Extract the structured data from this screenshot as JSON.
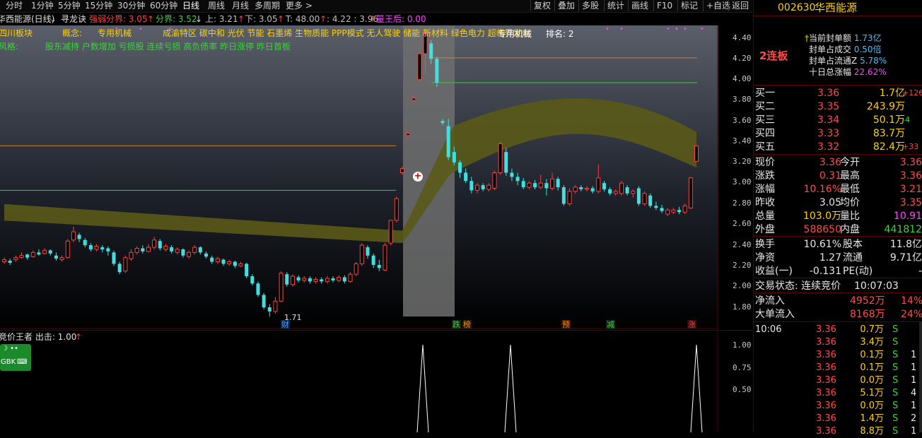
{
  "toolbar": {
    "periods": [
      "分时",
      "1分钟",
      "5分钟",
      "15分钟",
      "30分钟",
      "60分钟",
      "日线",
      "周线",
      "月线",
      "多周期",
      "更多 >"
    ],
    "active_period": "日线",
    "right_buttons": [
      "复权",
      "叠加",
      "多股",
      "统计",
      "画线",
      "F10",
      "标记",
      "+自选",
      "返回"
    ]
  },
  "header": {
    "stock_name": "华西能源(日线)",
    "indicator": "寻龙诀",
    "strong_weak_label": "强弱分界: 3.05",
    "boundary_label": "分界: 3.52",
    "up_label": "上: 3.21",
    "down_label": "下: 3.05",
    "t_label": "T: 48.00",
    "ratio_label": ": 4.22 : 3.96",
    "king_label": "量王后: 0.00",
    "sector_line": "四川板块",
    "concept_label": "概念:",
    "concept_main": "专用机械",
    "concepts": "成渝特区 碳中和 光伏 节能 石墨烯 生物质能 PPP模式 无人驾驶 储能 新材料 绿色电力 超临界发电",
    "overlay_tag": "专用机械",
    "rank_label": "排名: 2",
    "risk_prefix": "风格:",
    "risk_items": "股东减持 户数增加 亏损股 连续亏损 高负债率 昨日涨停 昨日首板"
  },
  "yaxis_main": [
    "4.40",
    "4.20",
    "4.00",
    "3.80",
    "3.60",
    "3.40",
    "3.20",
    "3.00",
    "2.80",
    "2.60",
    "2.40",
    "2.20",
    "2.00",
    "1.80"
  ],
  "low_marker": "1.71",
  "event_markers": [
    {
      "text": "财",
      "color": "#40a0ff"
    },
    {
      "text": "跌",
      "color": "#3cd23c"
    },
    {
      "text": "榜",
      "color": "#ff8800"
    },
    {
      "text": "预",
      "color": "#ff8800"
    },
    {
      "text": "减",
      "color": "#3cd23c"
    },
    {
      "text": "涨",
      "color": "#ff4040"
    }
  ],
  "sub_panel": {
    "title": "竞价王者 出击: 1.00",
    "yaxis": [
      "1.00",
      "0.75",
      "0.50"
    ],
    "ime_label": "GBK"
  },
  "right_panel": {
    "code": "002630",
    "name": "华西能源",
    "streak": "2连板",
    "seal_amount_label": "当前封单额",
    "seal_amount": "1.73亿",
    "seal_vol_label": "封单占成交",
    "seal_vol": "0.50倍",
    "seal_float_label": "封单占流通Z",
    "seal_float": "5.78%",
    "ten_day_label": "十日总涨幅",
    "ten_day": "22.62%",
    "bids": [
      {
        "label": "买一",
        "price": "3.36",
        "vol": "1.7亿",
        "chg": "+126"
      },
      {
        "label": "买二",
        "price": "3.35",
        "vol": "243.9万",
        "chg": ""
      },
      {
        "label": "买三",
        "price": "3.34",
        "vol": "50.1万",
        "chg": "-4"
      },
      {
        "label": "买四",
        "price": "3.33",
        "vol": "83.7万",
        "chg": ""
      },
      {
        "label": "买五",
        "price": "3.32",
        "vol": "82.4万",
        "chg": "+33"
      }
    ],
    "stats": [
      {
        "l1": "现价",
        "v1": "3.36",
        "c1": "red",
        "l2": "今开",
        "v2": "3.36",
        "c2": "red"
      },
      {
        "l1": "涨跌",
        "v1": "0.31",
        "c1": "red",
        "l2": "最高",
        "v2": "3.36",
        "c2": "red"
      },
      {
        "l1": "涨幅",
        "v1": "10.16%",
        "c1": "red",
        "l2": "最低",
        "v2": "3.21",
        "c2": "red"
      },
      {
        "l1": "昨收",
        "v1": "3.05",
        "c1": "white",
        "l2": "均价",
        "v2": "3.35",
        "c2": "red"
      },
      {
        "l1": "总量",
        "v1": "103.0万",
        "c1": "yellow",
        "l2": "量比",
        "v2": "10.91",
        "c2": "mag"
      },
      {
        "l1": "外盘",
        "v1": "588650",
        "c1": "red",
        "l2": "内盘",
        "v2": "441812",
        "c2": "green"
      }
    ],
    "stats2": [
      {
        "l1": "换手",
        "v1": "10.61%",
        "l2": "股本",
        "v2": "11.8亿"
      },
      {
        "l1": "净资",
        "v1": "1.27",
        "l2": "流通",
        "v2": "9.71亿"
      },
      {
        "l1": "收益(一)",
        "v1": "-0.131",
        "l2": "PE(动)",
        "v2": "-"
      }
    ],
    "trade_status_label": "交易状态: 连续竞价",
    "trade_time": "10:07:03",
    "net_inflow_label": "净流入",
    "net_inflow": "4952万",
    "net_inflow_pct": "14%",
    "big_inflow_label": "大单流入",
    "big_inflow": "8168万",
    "big_inflow_pct": "24%",
    "ticks": [
      {
        "time": "10:06",
        "price": "3.36",
        "vol": "0.7万",
        "side": "S",
        "n": ""
      },
      {
        "time": "",
        "price": "3.36",
        "vol": "3.4万",
        "side": "S",
        "n": ""
      },
      {
        "time": "",
        "price": "3.36",
        "vol": "0.1万",
        "side": "S",
        "n": "1"
      },
      {
        "time": "",
        "price": "3.36",
        "vol": "0.1万",
        "side": "S",
        "n": "1"
      },
      {
        "time": "",
        "price": "3.36",
        "vol": "0.0万",
        "side": "S",
        "n": "1"
      },
      {
        "time": "",
        "price": "3.36",
        "vol": "5.1万",
        "side": "S",
        "n": "4"
      },
      {
        "time": "",
        "price": "3.36",
        "vol": "0.0万",
        "side": "S",
        "n": "1"
      },
      {
        "time": "",
        "price": "3.36",
        "vol": "1.4万",
        "side": "S",
        "n": "2"
      },
      {
        "time": "",
        "price": "3.36",
        "vol": "8.8万",
        "side": "S",
        "n": "1"
      }
    ]
  },
  "colors": {
    "up": "#ff4040",
    "down": "#40e0e0",
    "cloud": "#5a5a18",
    "bg": "#000000",
    "border": "#5a0000"
  },
  "chart_data": {
    "type": "candlestick",
    "y_range": [
      1.65,
      4.5
    ],
    "candles": [
      {
        "o": 2.24,
        "c": 2.26,
        "h": 2.28,
        "l": 2.22
      },
      {
        "o": 2.25,
        "c": 2.23,
        "h": 2.27,
        "l": 2.21
      },
      {
        "o": 2.26,
        "c": 2.28,
        "h": 2.3,
        "l": 2.24
      },
      {
        "o": 2.28,
        "c": 2.3,
        "h": 2.33,
        "l": 2.27
      },
      {
        "o": 2.31,
        "c": 2.28,
        "h": 2.32,
        "l": 2.26
      },
      {
        "o": 2.29,
        "c": 2.33,
        "h": 2.35,
        "l": 2.28
      },
      {
        "o": 2.33,
        "c": 2.31,
        "h": 2.36,
        "l": 2.3
      },
      {
        "o": 2.32,
        "c": 2.35,
        "h": 2.37,
        "l": 2.31
      },
      {
        "o": 2.35,
        "c": 2.32,
        "h": 2.36,
        "l": 2.3
      },
      {
        "o": 2.3,
        "c": 2.27,
        "h": 2.33,
        "l": 2.25
      },
      {
        "o": 2.26,
        "c": 2.28,
        "h": 2.3,
        "l": 2.24
      },
      {
        "o": 2.28,
        "c": 2.44,
        "h": 2.46,
        "l": 2.27
      },
      {
        "o": 2.45,
        "c": 2.53,
        "h": 2.58,
        "l": 2.43
      },
      {
        "o": 2.5,
        "c": 2.46,
        "h": 2.52,
        "l": 2.43
      },
      {
        "o": 2.45,
        "c": 2.4,
        "h": 2.47,
        "l": 2.38
      },
      {
        "o": 2.4,
        "c": 2.36,
        "h": 2.42,
        "l": 2.34
      },
      {
        "o": 2.36,
        "c": 2.39,
        "h": 2.41,
        "l": 2.34
      },
      {
        "o": 2.38,
        "c": 2.36,
        "h": 2.4,
        "l": 2.33
      },
      {
        "o": 2.37,
        "c": 2.34,
        "h": 2.39,
        "l": 2.3
      },
      {
        "o": 2.33,
        "c": 2.22,
        "h": 2.35,
        "l": 2.2
      },
      {
        "o": 2.22,
        "c": 2.14,
        "h": 2.24,
        "l": 2.12
      },
      {
        "o": 2.15,
        "c": 2.28,
        "h": 2.3,
        "l": 2.13
      },
      {
        "o": 2.27,
        "c": 2.33,
        "h": 2.36,
        "l": 2.25
      },
      {
        "o": 2.33,
        "c": 2.37,
        "h": 2.39,
        "l": 2.31
      },
      {
        "o": 2.37,
        "c": 2.34,
        "h": 2.4,
        "l": 2.32
      },
      {
        "o": 2.34,
        "c": 2.38,
        "h": 2.41,
        "l": 2.33
      },
      {
        "o": 2.38,
        "c": 2.45,
        "h": 2.48,
        "l": 2.36
      },
      {
        "o": 2.44,
        "c": 2.37,
        "h": 2.46,
        "l": 2.35
      },
      {
        "o": 2.36,
        "c": 2.39,
        "h": 2.41,
        "l": 2.34
      },
      {
        "o": 2.38,
        "c": 2.34,
        "h": 2.4,
        "l": 2.32
      },
      {
        "o": 2.33,
        "c": 2.36,
        "h": 2.38,
        "l": 2.31
      },
      {
        "o": 2.36,
        "c": 2.3,
        "h": 2.37,
        "l": 2.28
      },
      {
        "o": 2.29,
        "c": 2.33,
        "h": 2.35,
        "l": 2.27
      },
      {
        "o": 2.33,
        "c": 2.38,
        "h": 2.4,
        "l": 2.31
      },
      {
        "o": 2.38,
        "c": 2.33,
        "h": 2.39,
        "l": 2.31
      },
      {
        "o": 2.32,
        "c": 2.29,
        "h": 2.34,
        "l": 2.27
      },
      {
        "o": 2.28,
        "c": 2.24,
        "h": 2.3,
        "l": 2.22
      },
      {
        "o": 2.24,
        "c": 2.27,
        "h": 2.29,
        "l": 2.22
      },
      {
        "o": 2.26,
        "c": 2.22,
        "h": 2.27,
        "l": 2.2
      },
      {
        "o": 2.22,
        "c": 2.24,
        "h": 2.26,
        "l": 2.2
      },
      {
        "o": 2.24,
        "c": 2.2,
        "h": 2.25,
        "l": 2.18
      },
      {
        "o": 2.2,
        "c": 2.22,
        "h": 2.24,
        "l": 2.19
      },
      {
        "o": 2.22,
        "c": 2.1,
        "h": 2.23,
        "l": 2.08
      },
      {
        "o": 2.1,
        "c": 2.03,
        "h": 2.12,
        "l": 2.01
      },
      {
        "o": 2.03,
        "c": 1.92,
        "h": 2.05,
        "l": 1.9
      },
      {
        "o": 1.92,
        "c": 1.8,
        "h": 1.94,
        "l": 1.78
      },
      {
        "o": 1.8,
        "c": 1.76,
        "h": 1.83,
        "l": 1.71
      },
      {
        "o": 1.76,
        "c": 1.86,
        "h": 1.9,
        "l": 1.74
      },
      {
        "o": 1.86,
        "c": 2.13,
        "h": 2.15,
        "l": 1.85
      },
      {
        "o": 2.12,
        "c": 2.02,
        "h": 2.14,
        "l": 2.0
      },
      {
        "o": 2.02,
        "c": 2.1,
        "h": 2.12,
        "l": 2.0
      },
      {
        "o": 2.09,
        "c": 2.06,
        "h": 2.11,
        "l": 2.04
      },
      {
        "o": 2.06,
        "c": 2.08,
        "h": 2.1,
        "l": 2.04
      },
      {
        "o": 2.08,
        "c": 2.05,
        "h": 2.1,
        "l": 2.03
      },
      {
        "o": 2.05,
        "c": 2.07,
        "h": 2.09,
        "l": 2.03
      },
      {
        "o": 2.07,
        "c": 2.05,
        "h": 2.09,
        "l": 2.03
      },
      {
        "o": 2.05,
        "c": 2.08,
        "h": 2.1,
        "l": 2.03
      },
      {
        "o": 2.08,
        "c": 2.06,
        "h": 2.1,
        "l": 2.04
      },
      {
        "o": 2.06,
        "c": 2.09,
        "h": 2.11,
        "l": 2.04
      },
      {
        "o": 2.09,
        "c": 2.05,
        "h": 2.11,
        "l": 2.03
      },
      {
        "o": 2.05,
        "c": 2.12,
        "h": 2.14,
        "l": 2.04
      },
      {
        "o": 2.12,
        "c": 2.22,
        "h": 2.24,
        "l": 2.1
      },
      {
        "o": 2.22,
        "c": 2.4,
        "h": 2.42,
        "l": 2.2
      },
      {
        "o": 2.38,
        "c": 2.3,
        "h": 2.4,
        "l": 2.27
      },
      {
        "o": 2.3,
        "c": 2.21,
        "h": 2.32,
        "l": 2.18
      },
      {
        "o": 2.21,
        "c": 2.18,
        "h": 2.26,
        "l": 2.15
      },
      {
        "o": 2.16,
        "c": 2.4,
        "h": 2.42,
        "l": 2.15
      },
      {
        "o": 2.42,
        "c": 2.64,
        "h": 2.64,
        "l": 2.4
      },
      {
        "o": 2.64,
        "c": 2.85,
        "h": 2.87,
        "l": 2.62
      },
      {
        "o": 3.1,
        "c": 3.14,
        "h": 3.16,
        "l": 3.08
      },
      {
        "o": 3.46,
        "c": 3.48,
        "h": 3.5,
        "l": 3.44
      },
      {
        "o": 3.8,
        "c": 3.82,
        "h": 3.84,
        "l": 3.78
      },
      {
        "o": 4.0,
        "c": 4.25,
        "h": 4.3,
        "l": 3.98
      },
      {
        "o": 4.25,
        "c": 4.45,
        "h": 4.5,
        "l": 4.05
      },
      {
        "o": 4.35,
        "c": 4.2,
        "h": 4.38,
        "l": 4.15
      },
      {
        "o": 4.2,
        "c": 3.97,
        "h": 4.22,
        "l": 3.93
      },
      {
        "o": 3.6,
        "c": 3.58,
        "h": 3.62,
        "l": 3.56
      },
      {
        "o": 3.55,
        "c": 3.25,
        "h": 3.62,
        "l": 3.22
      },
      {
        "o": 3.3,
        "c": 3.2,
        "h": 3.35,
        "l": 3.17
      },
      {
        "o": 3.2,
        "c": 3.1,
        "h": 3.22,
        "l": 3.05
      },
      {
        "o": 3.1,
        "c": 3.02,
        "h": 3.14,
        "l": 3.0
      },
      {
        "o": 3.02,
        "c": 2.93,
        "h": 3.06,
        "l": 2.9
      },
      {
        "o": 2.93,
        "c": 2.98,
        "h": 3.0,
        "l": 2.9
      },
      {
        "o": 2.98,
        "c": 2.94,
        "h": 3.0,
        "l": 2.92
      },
      {
        "o": 2.94,
        "c": 2.98,
        "h": 3.0,
        "l": 2.92
      },
      {
        "o": 2.95,
        "c": 3.1,
        "h": 3.12,
        "l": 2.93
      },
      {
        "o": 3.1,
        "c": 3.38,
        "h": 3.4,
        "l": 3.08
      },
      {
        "o": 3.3,
        "c": 3.1,
        "h": 3.34,
        "l": 3.07
      },
      {
        "o": 3.1,
        "c": 3.06,
        "h": 3.14,
        "l": 3.02
      },
      {
        "o": 3.06,
        "c": 3.02,
        "h": 3.1,
        "l": 2.98
      },
      {
        "o": 3.02,
        "c": 2.96,
        "h": 3.05,
        "l": 2.94
      },
      {
        "o": 2.96,
        "c": 3.0,
        "h": 3.02,
        "l": 2.94
      },
      {
        "o": 3.0,
        "c": 2.96,
        "h": 3.03,
        "l": 2.94
      },
      {
        "o": 2.96,
        "c": 3.0,
        "h": 3.08,
        "l": 2.94
      },
      {
        "o": 3.0,
        "c": 2.95,
        "h": 3.04,
        "l": 2.88
      },
      {
        "o": 2.95,
        "c": 3.04,
        "h": 3.1,
        "l": 2.93
      },
      {
        "o": 3.04,
        "c": 2.96,
        "h": 3.06,
        "l": 2.93
      },
      {
        "o": 2.96,
        "c": 2.8,
        "h": 2.98,
        "l": 2.78
      },
      {
        "o": 2.8,
        "c": 2.92,
        "h": 2.95,
        "l": 2.78
      },
      {
        "o": 2.92,
        "c": 2.96,
        "h": 2.98,
        "l": 2.9
      },
      {
        "o": 2.96,
        "c": 2.94,
        "h": 2.98,
        "l": 2.92
      },
      {
        "o": 2.94,
        "c": 2.95,
        "h": 2.97,
        "l": 2.92
      },
      {
        "o": 2.95,
        "c": 2.92,
        "h": 2.97,
        "l": 2.9
      },
      {
        "o": 2.92,
        "c": 3.05,
        "h": 3.18,
        "l": 2.9
      },
      {
        "o": 3.0,
        "c": 2.94,
        "h": 3.02,
        "l": 2.92
      },
      {
        "o": 2.94,
        "c": 2.9,
        "h": 2.96,
        "l": 2.88
      },
      {
        "o": 2.9,
        "c": 2.92,
        "h": 2.94,
        "l": 2.88
      },
      {
        "o": 2.9,
        "c": 3.0,
        "h": 3.02,
        "l": 2.88
      },
      {
        "o": 2.96,
        "c": 2.9,
        "h": 2.98,
        "l": 2.88
      },
      {
        "o": 2.9,
        "c": 2.92,
        "h": 2.94,
        "l": 2.86
      },
      {
        "o": 2.95,
        "c": 2.8,
        "h": 2.97,
        "l": 2.78
      },
      {
        "o": 2.8,
        "c": 2.9,
        "h": 2.92,
        "l": 2.78
      },
      {
        "o": 2.88,
        "c": 2.78,
        "h": 2.9,
        "l": 2.76
      },
      {
        "o": 2.78,
        "c": 2.76,
        "h": 2.82,
        "l": 2.74
      },
      {
        "o": 2.76,
        "c": 2.73,
        "h": 2.79,
        "l": 2.71
      },
      {
        "o": 2.7,
        "c": 2.74,
        "h": 2.76,
        "l": 2.68
      },
      {
        "o": 2.72,
        "c": 2.74,
        "h": 2.76,
        "l": 2.7
      },
      {
        "o": 2.74,
        "c": 2.72,
        "h": 2.77,
        "l": 2.7
      },
      {
        "o": 2.72,
        "c": 2.78,
        "h": 2.8,
        "l": 2.7
      },
      {
        "o": 2.76,
        "c": 3.05,
        "h": 3.06,
        "l": 2.75
      },
      {
        "o": 3.21,
        "c": 3.36,
        "h": 3.36,
        "l": 3.21
      }
    ],
    "hlines": [
      {
        "y": 4.21,
        "color": "#d08030"
      },
      {
        "y": 3.97,
        "color": "#30d030"
      },
      {
        "y": 3.36,
        "color": "#d08030"
      },
      {
        "y": 2.93,
        "color": "#30d030"
      }
    ],
    "sub_spikes": [
      0.0,
      1.0,
      0.0
    ]
  }
}
